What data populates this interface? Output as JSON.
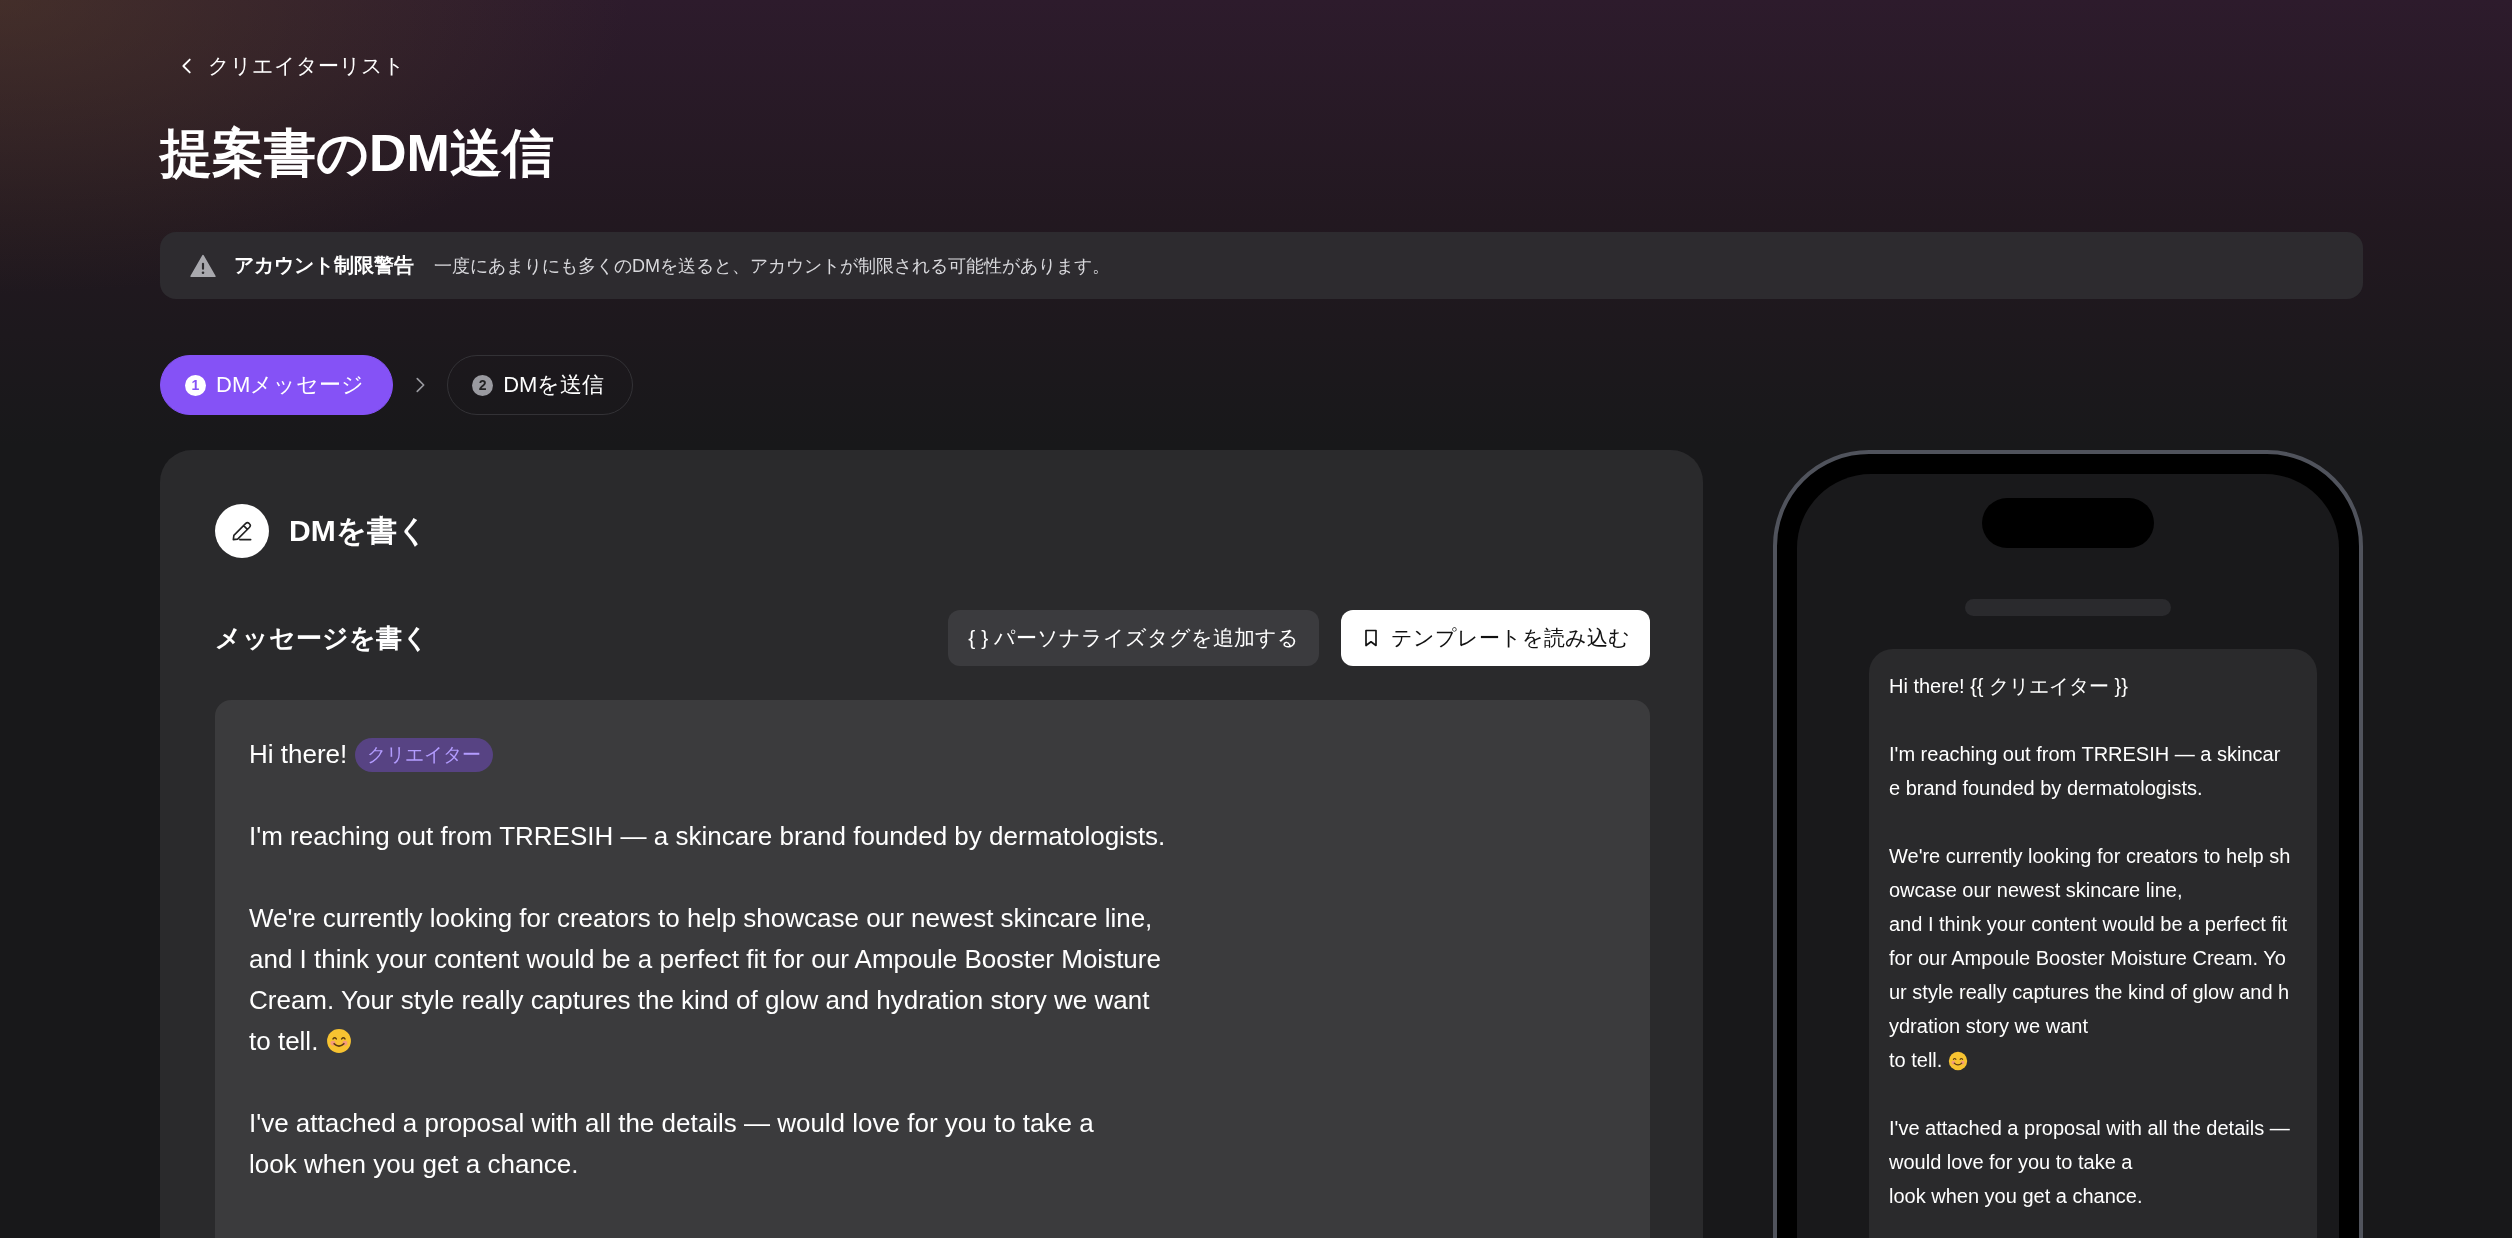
{
  "back_link": {
    "label": "クリエイターリスト"
  },
  "title": "提案書のDM送信",
  "warning": {
    "title": "アカウント制限警告",
    "message": "一度にあまりにも多くのDMを送ると、アカウントが制限される可能性があります。"
  },
  "steps": [
    {
      "number": "1",
      "label": "DMメッセージ",
      "selected": true
    },
    {
      "number": "2",
      "label": "DMを送信",
      "selected": false
    }
  ],
  "compose": {
    "heading": "DMを書く",
    "subheading": "メッセージを書く",
    "buttons": [
      {
        "kind": "tag",
        "label": "{ } パーソナライズタグを追加する"
      },
      {
        "kind": "template",
        "label": "テンプレートを読み込む"
      }
    ],
    "editor": {
      "greeting": "Hi there!",
      "tag": "クリエイター",
      "paragraphs": [
        {
          "text": "I'm reaching out from TRRESIH — a skincare brand founded by dermatologists.",
          "emoji": false
        },
        {
          "text": "We're currently looking for creators to help showcase our newest skincare line,\nand I think your content would be a perfect fit for our Ampoule Booster Moisture Cream. Your style really captures the kind of glow and hydration story we want\nto tell.",
          "emoji": true
        },
        {
          "text": "I've attached a proposal with all the details — would love for you to take a\nlook when you get a chance.",
          "emoji": false
        }
      ]
    }
  },
  "preview": {
    "paragraphs": [
      {
        "text": "Hi there! {{ クリエイター }}",
        "emoji": false
      },
      {
        "text": "I'm reaching out from TRRESIH — a skincare brand founded by dermatologists.",
        "emoji": false
      },
      {
        "text": "We're currently looking for creators to help showcase our newest skincare line,\nand I think your content would be a perfect fit for our Ampoule Booster Moisture Cream. Your style really captures the kind of glow and hydration story we want\nto tell.",
        "emoji": true
      },
      {
        "text": "I've attached a proposal with all the details — would love for you to take a\nlook when you get a chance.",
        "emoji": false
      }
    ]
  }
}
